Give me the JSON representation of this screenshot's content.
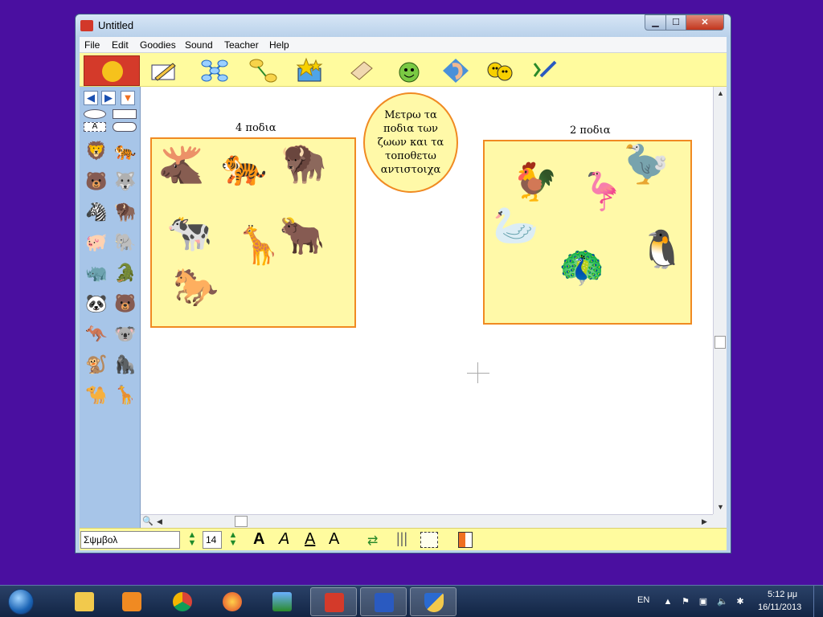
{
  "window": {
    "title": "Untitled",
    "min_label": "▁",
    "max_label": "☐",
    "close_label": "✕"
  },
  "menu": [
    "File",
    "Edit",
    "Goodies",
    "Sound",
    "Teacher",
    "Help"
  ],
  "toolbar": {
    "tools": [
      "pencil-icon",
      "network-icon",
      "link-arrow-icon",
      "star-box-icon",
      "eraser-icon",
      "smiley-icon",
      "ear-icon",
      "faces-icon",
      "paintbrush-icon"
    ]
  },
  "palette": {
    "prev": "◀",
    "next": "▶",
    "down": "▼",
    "text_tool": "A",
    "animals": [
      "🦁",
      "🐅",
      "🐻",
      "🐺",
      "🦓",
      "🦬",
      "🐖",
      "🐘",
      "🦏",
      "🐊",
      "🐼",
      "🐻",
      "🦘",
      "🐨",
      "🐒",
      "🦍",
      "🐪",
      "🦒"
    ]
  },
  "canvas": {
    "left_label": "4 ποδια",
    "right_label": "2 ποδια",
    "bubble_lines": [
      "Μετρω τα",
      "ποδια των",
      "ζωων και τα",
      "τοποθετω",
      "αντιστοιχα"
    ],
    "left_animals": [
      "🫎",
      "🐅",
      "🦬",
      "🐄",
      "🦒",
      "🐂",
      "🐎"
    ],
    "right_animals": [
      "🐓",
      "🦩",
      "🦤",
      "🦢",
      "🦚",
      "🐧"
    ]
  },
  "statusbar": {
    "font": "Σψμβολ",
    "size": "14"
  },
  "taskbar": {
    "lang": "EN",
    "time": "5:12 μμ",
    "date": "16/11/2013"
  },
  "colors": {
    "desktop": "#4a0fa0",
    "canvas_box_fill": "#fff9a8",
    "canvas_box_border": "#f08a22",
    "toolbar": "#fffb9e"
  }
}
